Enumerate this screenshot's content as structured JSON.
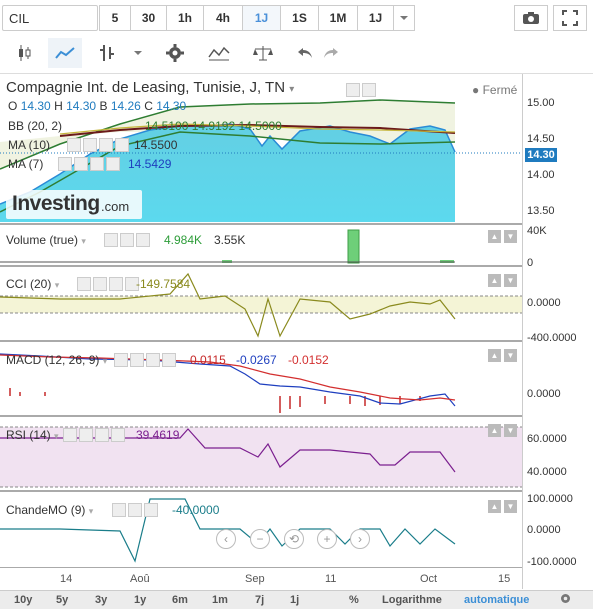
{
  "toolbar": {
    "symbol": "CIL",
    "intervals": [
      "5",
      "30",
      "1h",
      "4h",
      "1J",
      "1S",
      "1M",
      "1J"
    ],
    "active_interval_index": 4,
    "icons": [
      "camera-icon",
      "fullscreen-icon"
    ]
  },
  "toolbar2": {
    "tools": [
      "candlestick-icon",
      "line-chart-icon",
      "bar-chart-icon",
      "dropdown-icon",
      "settings-icon",
      "indicators-icon",
      "scale-icon",
      "undo-icon",
      "redo-icon"
    ]
  },
  "main": {
    "title": "Compagnie Int. de Leasing, Tunisie, J, TN",
    "status": "Fermé",
    "ohlc": {
      "o_label": "O",
      "o": "14.30",
      "h_label": "H",
      "h": "14.30",
      "b_label": "B",
      "b": "14.26",
      "c_label": "C",
      "c": "14.30"
    },
    "bb": {
      "label": "BB (20, 2)",
      "v1": "14.5100",
      "v2": "14.9192",
      "v3": "14.5000"
    },
    "ma10": {
      "label": "MA (10)",
      "value": "14.5500"
    },
    "ma7": {
      "label": "MA (7)",
      "value": "14.5429"
    },
    "logo": "Investing",
    "logo_suffix": ".com",
    "yticks": [
      "15.00",
      "14.50",
      "14.00",
      "13.50"
    ],
    "price_tag": "14.30"
  },
  "volume": {
    "label": "Volume (true)",
    "v1": "4.984K",
    "v2": "3.55K",
    "yticks": [
      "40K",
      "0"
    ]
  },
  "cci": {
    "label": "CCI (20)",
    "value": "-149.7584",
    "yticks": [
      "0.0000",
      "-400.0000"
    ]
  },
  "macd": {
    "label": "MACD (12, 26, 9)",
    "v1": "-0.0115",
    "v2": "-0.0267",
    "v3": "-0.0152",
    "yticks": [
      "0.0000"
    ]
  },
  "rsi": {
    "label": "RSI (14)",
    "value": "39.4619",
    "yticks": [
      "60.0000",
      "40.0000"
    ]
  },
  "cmo": {
    "label": "ChandeMO (9)",
    "value": "-40.0000",
    "yticks": [
      "100.0000",
      "0.0000",
      "-100.0000"
    ]
  },
  "xaxis": {
    "ticks": [
      "14",
      "Aoû",
      "Sep",
      "11",
      "Oct",
      "15"
    ]
  },
  "nav": [
    "‹",
    "−",
    "⟲",
    "+",
    "›"
  ],
  "bottom": {
    "ranges": [
      "10y",
      "5y",
      "3y",
      "1y",
      "6m",
      "1m",
      "7j",
      "1j"
    ],
    "percent": "%",
    "log": "Logarithme",
    "auto": "automatique"
  },
  "colors": {
    "area": "#5fd3e6",
    "ma": "#6b1a1a",
    "bb": "#2e7d32",
    "accent": "#3c8fd6"
  }
}
